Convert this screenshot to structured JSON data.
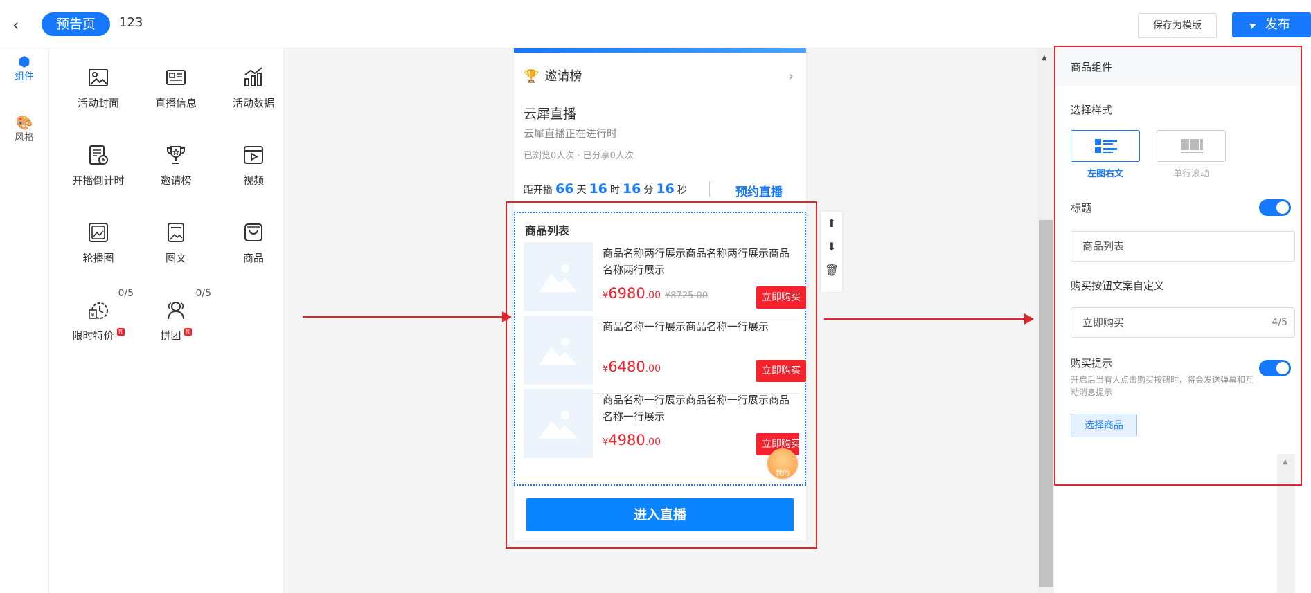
{
  "header": {
    "back_icon": "chevron-left-icon",
    "page_type": "预告页",
    "page_name": "123",
    "save_template": "保存为模版",
    "publish": "发布",
    "publish_icon": "send-icon"
  },
  "rail": {
    "items": [
      {
        "label": "组件",
        "icon": "cube-icon",
        "active": true
      },
      {
        "label": "风格",
        "icon": "palette-icon",
        "active": false
      }
    ]
  },
  "components": [
    {
      "label": "活动封面",
      "icon": "image-icon"
    },
    {
      "label": "直播信息",
      "icon": "news-card-icon"
    },
    {
      "label": "活动数据",
      "icon": "bar-chart-icon"
    },
    {
      "label": "开播倒计时",
      "icon": "schedule-doc-icon"
    },
    {
      "label": "邀请榜",
      "icon": "trophy-icon"
    },
    {
      "label": "视频",
      "icon": "video-icon"
    },
    {
      "label": "轮播图",
      "icon": "carousel-icon"
    },
    {
      "label": "图文",
      "icon": "image-text-icon"
    },
    {
      "label": "商品",
      "icon": "shopping-bag-icon"
    },
    {
      "label": "限时特价",
      "icon": "timer-icon",
      "quota": "0/5",
      "new": "N"
    },
    {
      "label": "拼团",
      "icon": "group-icon",
      "quota": "0/5",
      "new": "N"
    }
  ],
  "phone": {
    "invite_board": "邀请榜",
    "live_title": "云犀直播",
    "live_subtitle": "云犀直播正在进行时",
    "live_stats": "已浏览0人次 · 已分享0人次",
    "countdown": {
      "prefix": "距开播",
      "days": "66",
      "days_unit": "天",
      "hours": "16",
      "hours_unit": "时",
      "minutes": "16",
      "minutes_unit": "分",
      "seconds": "16",
      "seconds_unit": "秒"
    },
    "reserve": "预约直播",
    "product_list_title": "商品列表",
    "products": [
      {
        "name": "商品名称两行展示商品名称两行展示商品名称两行展示",
        "currency": "¥",
        "price": "6980",
        "decimals": ".00",
        "original": "¥8725.00",
        "buy": "立即购买"
      },
      {
        "name": "商品名称一行展示商品名称一行展示",
        "currency": "¥",
        "price": "6480",
        "decimals": ".00",
        "original": "",
        "buy": "立即购买"
      },
      {
        "name": "商品名称一行展示商品名称一行展示商品名称一行展示",
        "currency": "¥",
        "price": "4980",
        "decimals": ".00",
        "original": "",
        "buy": "立即购买"
      }
    ],
    "float_label": "我的",
    "enter_live": "进入直播"
  },
  "side_tools": [
    "move-up-icon",
    "move-down-icon",
    "delete-icon"
  ],
  "props": {
    "header": "商品组件",
    "style_label": "选择样式",
    "style_options": [
      {
        "label": "左图右文",
        "active": true
      },
      {
        "label": "单行滚动",
        "active": false
      }
    ],
    "title_label": "标题",
    "title_enabled": true,
    "title_value": "商品列表",
    "buy_text_label": "购买按钮文案自定义",
    "buy_text_value": "立即购买",
    "buy_text_count": "4/5",
    "buy_tip_label": "购买提示",
    "buy_tip_enabled": true,
    "buy_tip_hint": "开启后当有人点击购买按钮时，将会发送弹幕和互动消息提示",
    "select_products": "选择商品"
  },
  "colors": {
    "accent": "#1677ff",
    "price": "#f5222d",
    "annotation": "#e3242b"
  }
}
